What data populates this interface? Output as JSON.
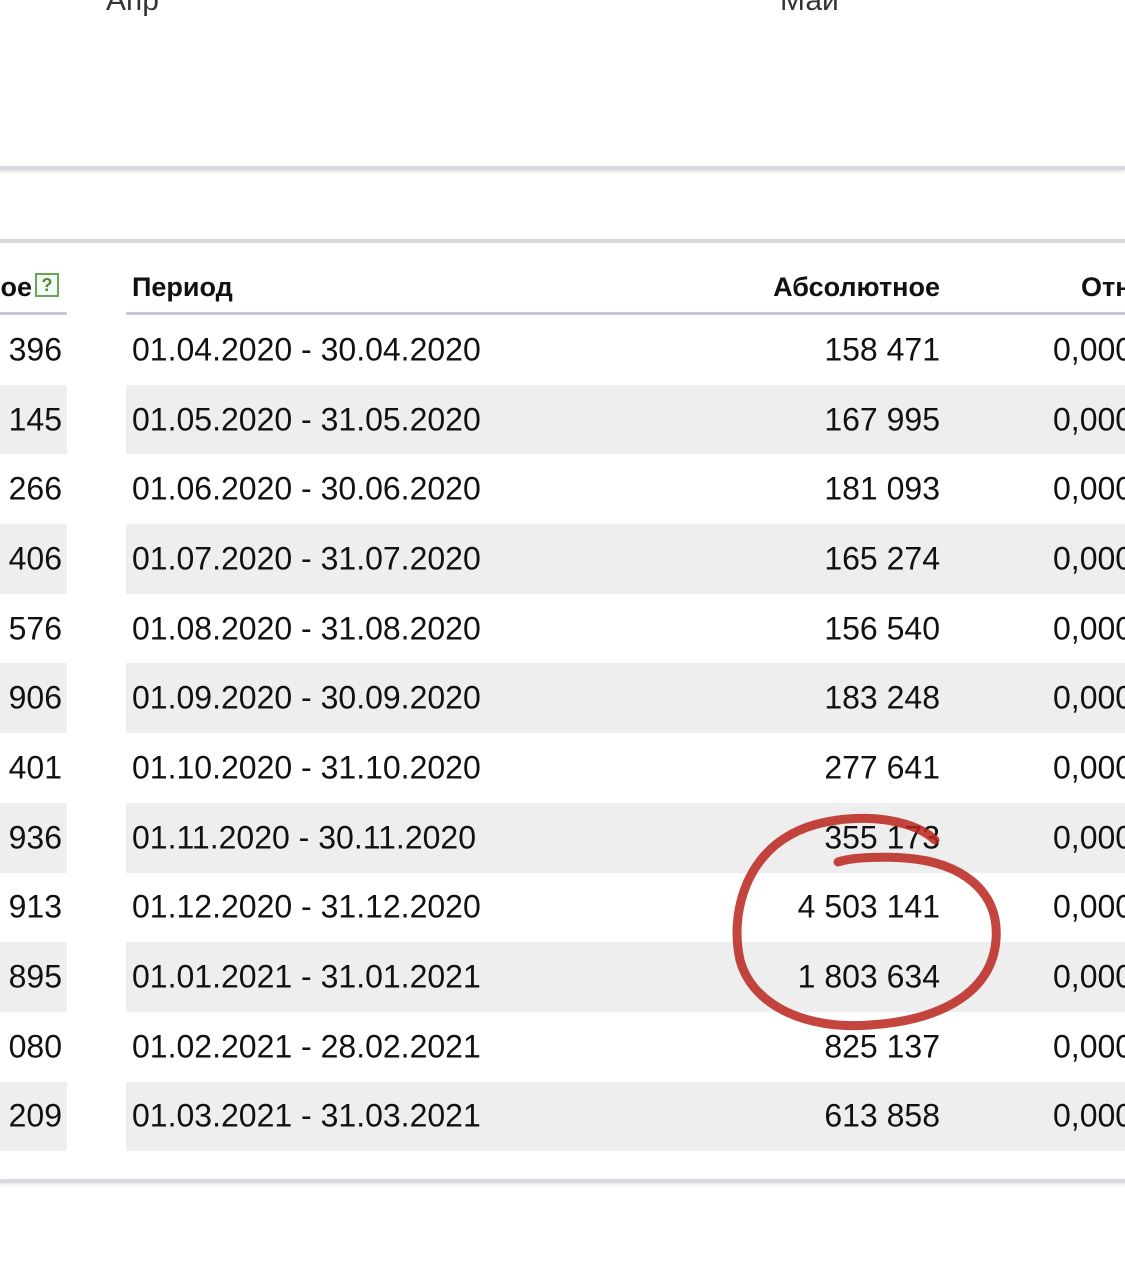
{
  "chart_axis": {
    "label_left": "Апр",
    "label_right": "Май"
  },
  "table": {
    "headers": {
      "left_partial": "ое",
      "period": "Период",
      "absolute": "Абсолютное",
      "relative_partial": "Отн"
    },
    "rows": [
      {
        "left": "396",
        "period": "01.04.2020 - 30.04.2020",
        "absolute": "158 471",
        "relative": "0,000"
      },
      {
        "left": "145",
        "period": "01.05.2020 - 31.05.2020",
        "absolute": "167 995",
        "relative": "0,000"
      },
      {
        "left": "266",
        "period": "01.06.2020 - 30.06.2020",
        "absolute": "181 093",
        "relative": "0,000"
      },
      {
        "left": "406",
        "period": "01.07.2020 - 31.07.2020",
        "absolute": "165 274",
        "relative": "0,000"
      },
      {
        "left": "576",
        "period": "01.08.2020 - 31.08.2020",
        "absolute": "156 540",
        "relative": "0,000"
      },
      {
        "left": "906",
        "period": "01.09.2020 - 30.09.2020",
        "absolute": "183 248",
        "relative": "0,000"
      },
      {
        "left": "401",
        "period": "01.10.2020 - 31.10.2020",
        "absolute": "277 641",
        "relative": "0,000"
      },
      {
        "left": "936",
        "period": "01.11.2020 - 30.11.2020",
        "absolute": "355 173",
        "relative": "0,000"
      },
      {
        "left": "913",
        "period": "01.12.2020 - 31.12.2020",
        "absolute": "4 503 141",
        "relative": "0,000"
      },
      {
        "left": "895",
        "period": "01.01.2021 - 31.01.2021",
        "absolute": "1 803 634",
        "relative": "0,000"
      },
      {
        "left": "080",
        "period": "01.02.2021 - 28.02.2021",
        "absolute": "825 137",
        "relative": "0,000"
      },
      {
        "left": "209",
        "period": "01.03.2021 - 31.03.2021",
        "absolute": "613 858",
        "relative": "0,000"
      }
    ]
  },
  "colors": {
    "annotation": "#b8251c",
    "row_alt": "#eeeeee",
    "header_underline": "#c9c7dc"
  },
  "icons": {
    "help": "help-icon"
  }
}
